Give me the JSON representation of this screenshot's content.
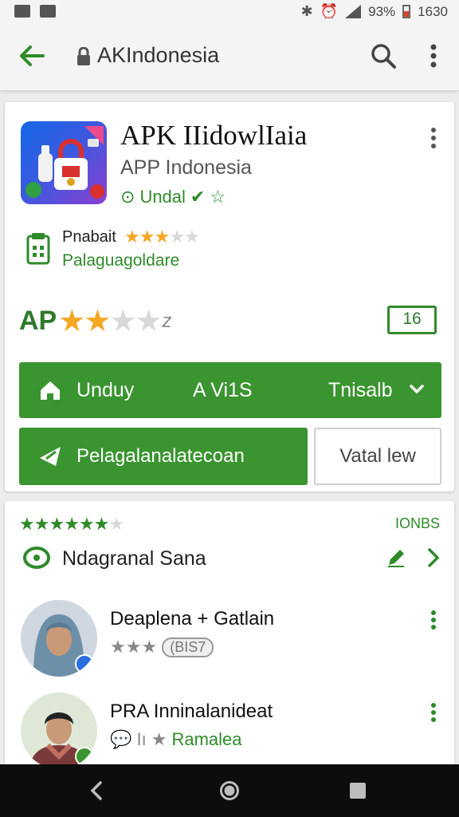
{
  "status_bar": {
    "battery": "93%",
    "time": "1630"
  },
  "app_bar": {
    "title": "AKIndonesia"
  },
  "app": {
    "title": "APK IIidowlIaia",
    "subtitle": "APP Indonesia",
    "badge_label": "Undal"
  },
  "developer": {
    "name": "Pnabait",
    "category": "Palaguagoldare",
    "stars": 3,
    "stars_max": 5
  },
  "rating": {
    "label": "AP",
    "stars": 2,
    "stars_max": 4,
    "suffix": "z",
    "age_badge": "16"
  },
  "install_bar": {
    "item1": "Unduy",
    "item2": "A  Vi1S",
    "item3": "Tnisalb"
  },
  "actions": {
    "primary_label": "Pelagalanalatecoan",
    "secondary_label": "Vatal lew"
  },
  "reviews": {
    "stars": 6,
    "stars_max": 7,
    "count": "IONBS",
    "header_title": "Ndagranal Sana",
    "items": [
      {
        "name": "Deaplena + Gatlain",
        "stars": 3,
        "pill": "(BIS7"
      },
      {
        "name": "PRA Inninalanideat",
        "meta_prefix": "💬 Iı",
        "meta_green": "Ramalea"
      }
    ]
  },
  "colors": {
    "accent_green": "#3a9430",
    "star_orange": "#f5a623",
    "star_empty": "#d9d9d9"
  }
}
